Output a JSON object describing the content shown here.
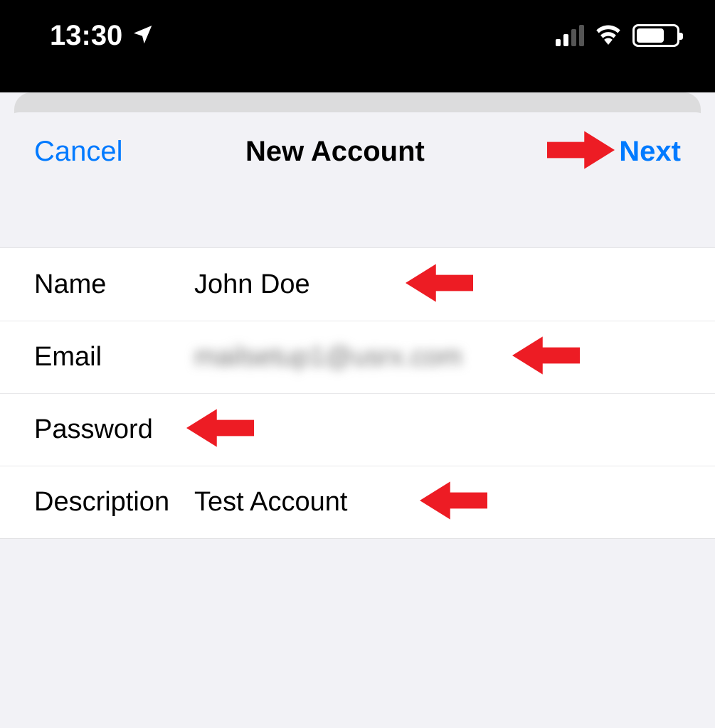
{
  "status": {
    "time": "13:30"
  },
  "nav": {
    "cancel": "Cancel",
    "title": "New Account",
    "next": "Next"
  },
  "fields": {
    "name_label": "Name",
    "name_value": "John Doe",
    "email_label": "Email",
    "email_value": "mailsetup1@usrx.com",
    "password_label": "Password",
    "password_value": "",
    "description_label": "Description",
    "description_value": "Test Account"
  }
}
